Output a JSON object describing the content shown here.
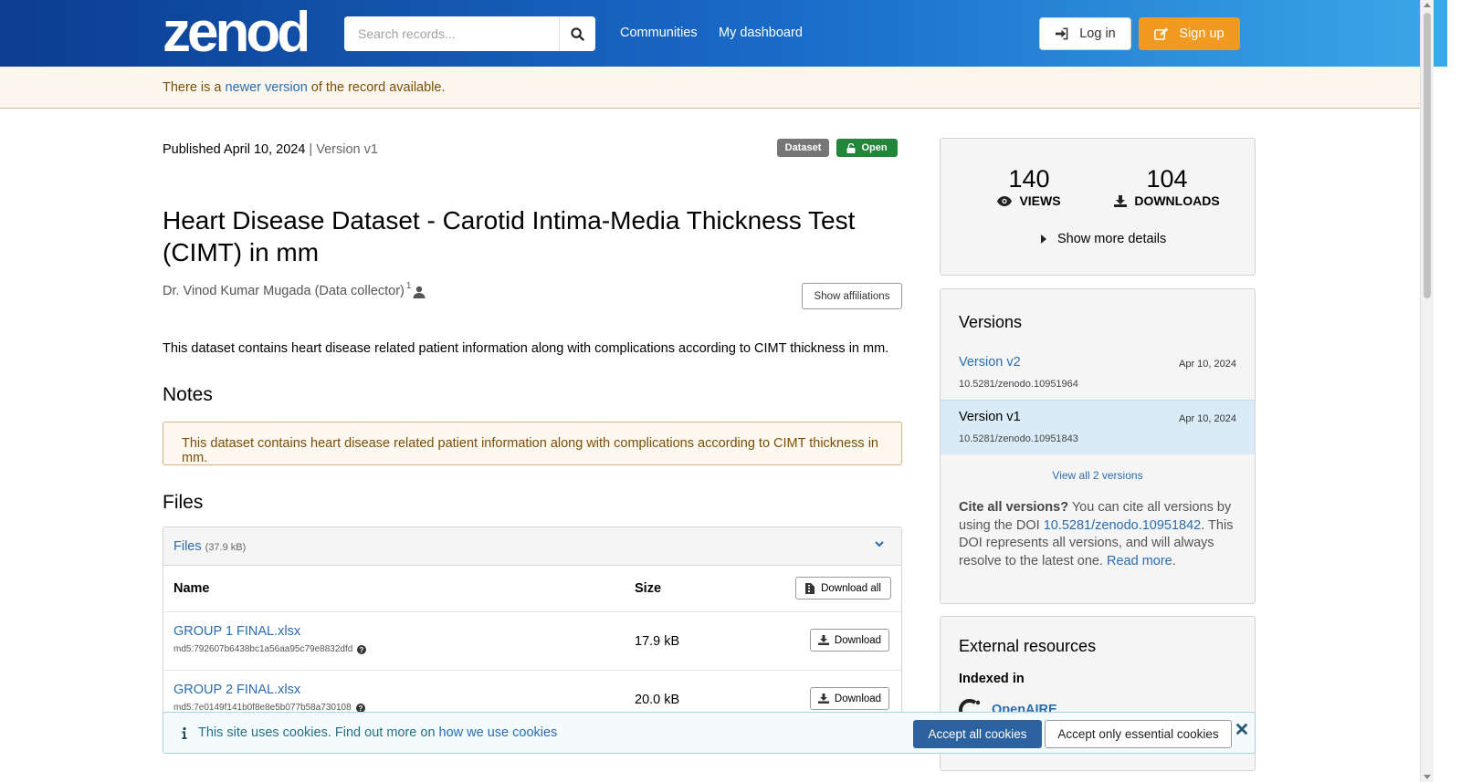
{
  "header": {
    "logo_text": "zenodo",
    "search_placeholder": "Search records...",
    "nav": [
      "Communities",
      "My dashboard"
    ],
    "login_label": "Log in",
    "signup_label": "Sign up"
  },
  "banner": {
    "prefix": "There is a ",
    "link": "newer version",
    "suffix": " of the record available."
  },
  "record": {
    "published": "Published April 10, 2024",
    "version_sep": " | Version v1",
    "badge_type": "Dataset",
    "badge_access": "Open",
    "title": "Heart Disease Dataset - Carotid Intima-Media Thickness Test (CIMT) in mm",
    "creator": "Dr. Vinod Kumar Mugada (Data collector)",
    "creator_sup": "1",
    "affiliations_label": "Show affiliations",
    "description": "This dataset contains heart disease related patient information along with complications according to CIMT thickness in mm.",
    "notes_heading": "Notes",
    "notes_text": "This dataset contains heart disease related patient information along with complications according to CIMT thickness in mm.",
    "files_heading": "Files"
  },
  "files": {
    "panel_title": "Files",
    "panel_size": "(37.9 kB)",
    "col_name": "Name",
    "col_size": "Size",
    "download_all": "Download all",
    "download_label": "Download",
    "rows": [
      {
        "name": "GROUP 1 FINAL.xlsx",
        "md5": "md5:792607b6438bc1a56aa95c79e8832dfd",
        "size": "17.9 kB"
      },
      {
        "name": "GROUP 2 FINAL.xlsx",
        "md5": "md5:7e0149f141b0f8e8e5b077b58a730108",
        "size": "20.0 kB"
      }
    ]
  },
  "stats": {
    "views": "140",
    "views_label": "VIEWS",
    "downloads": "104",
    "downloads_label": "DOWNLOADS",
    "more_details": "Show more details"
  },
  "versions": {
    "heading": "Versions",
    "items": [
      {
        "title": "Version v2",
        "date": "Apr 10, 2024",
        "doi": "10.5281/zenodo.10951964"
      },
      {
        "title": "Version v1",
        "date": "Apr 10, 2024",
        "doi": "10.5281/zenodo.10951843"
      }
    ],
    "view_all": "View all 2 versions",
    "cite_bold": "Cite all versions?",
    "cite_text1": " You can cite all versions by using the DOI ",
    "cite_doi": "10.5281/zenodo.10951842",
    "cite_text2": ". This DOI represents all versions, and will always resolve to the latest one. ",
    "cite_read_more": "Read more",
    "cite_end": "."
  },
  "external": {
    "heading": "External resources",
    "indexed_in": "Indexed in",
    "openaire": "OpenAIRE"
  },
  "cookies": {
    "text": "This site uses cookies. Find out more on ",
    "link": "how we use cookies",
    "accept_all": "Accept all cookies",
    "accept_essential": "Accept only essential cookies"
  },
  "colors": {
    "header_start": "#0b3d91",
    "header_end": "#3aa8e8",
    "signup": "#f29a1f",
    "link": "#2a6cb0",
    "badge_dataset": "#767676",
    "badge_open": "#21853a"
  }
}
